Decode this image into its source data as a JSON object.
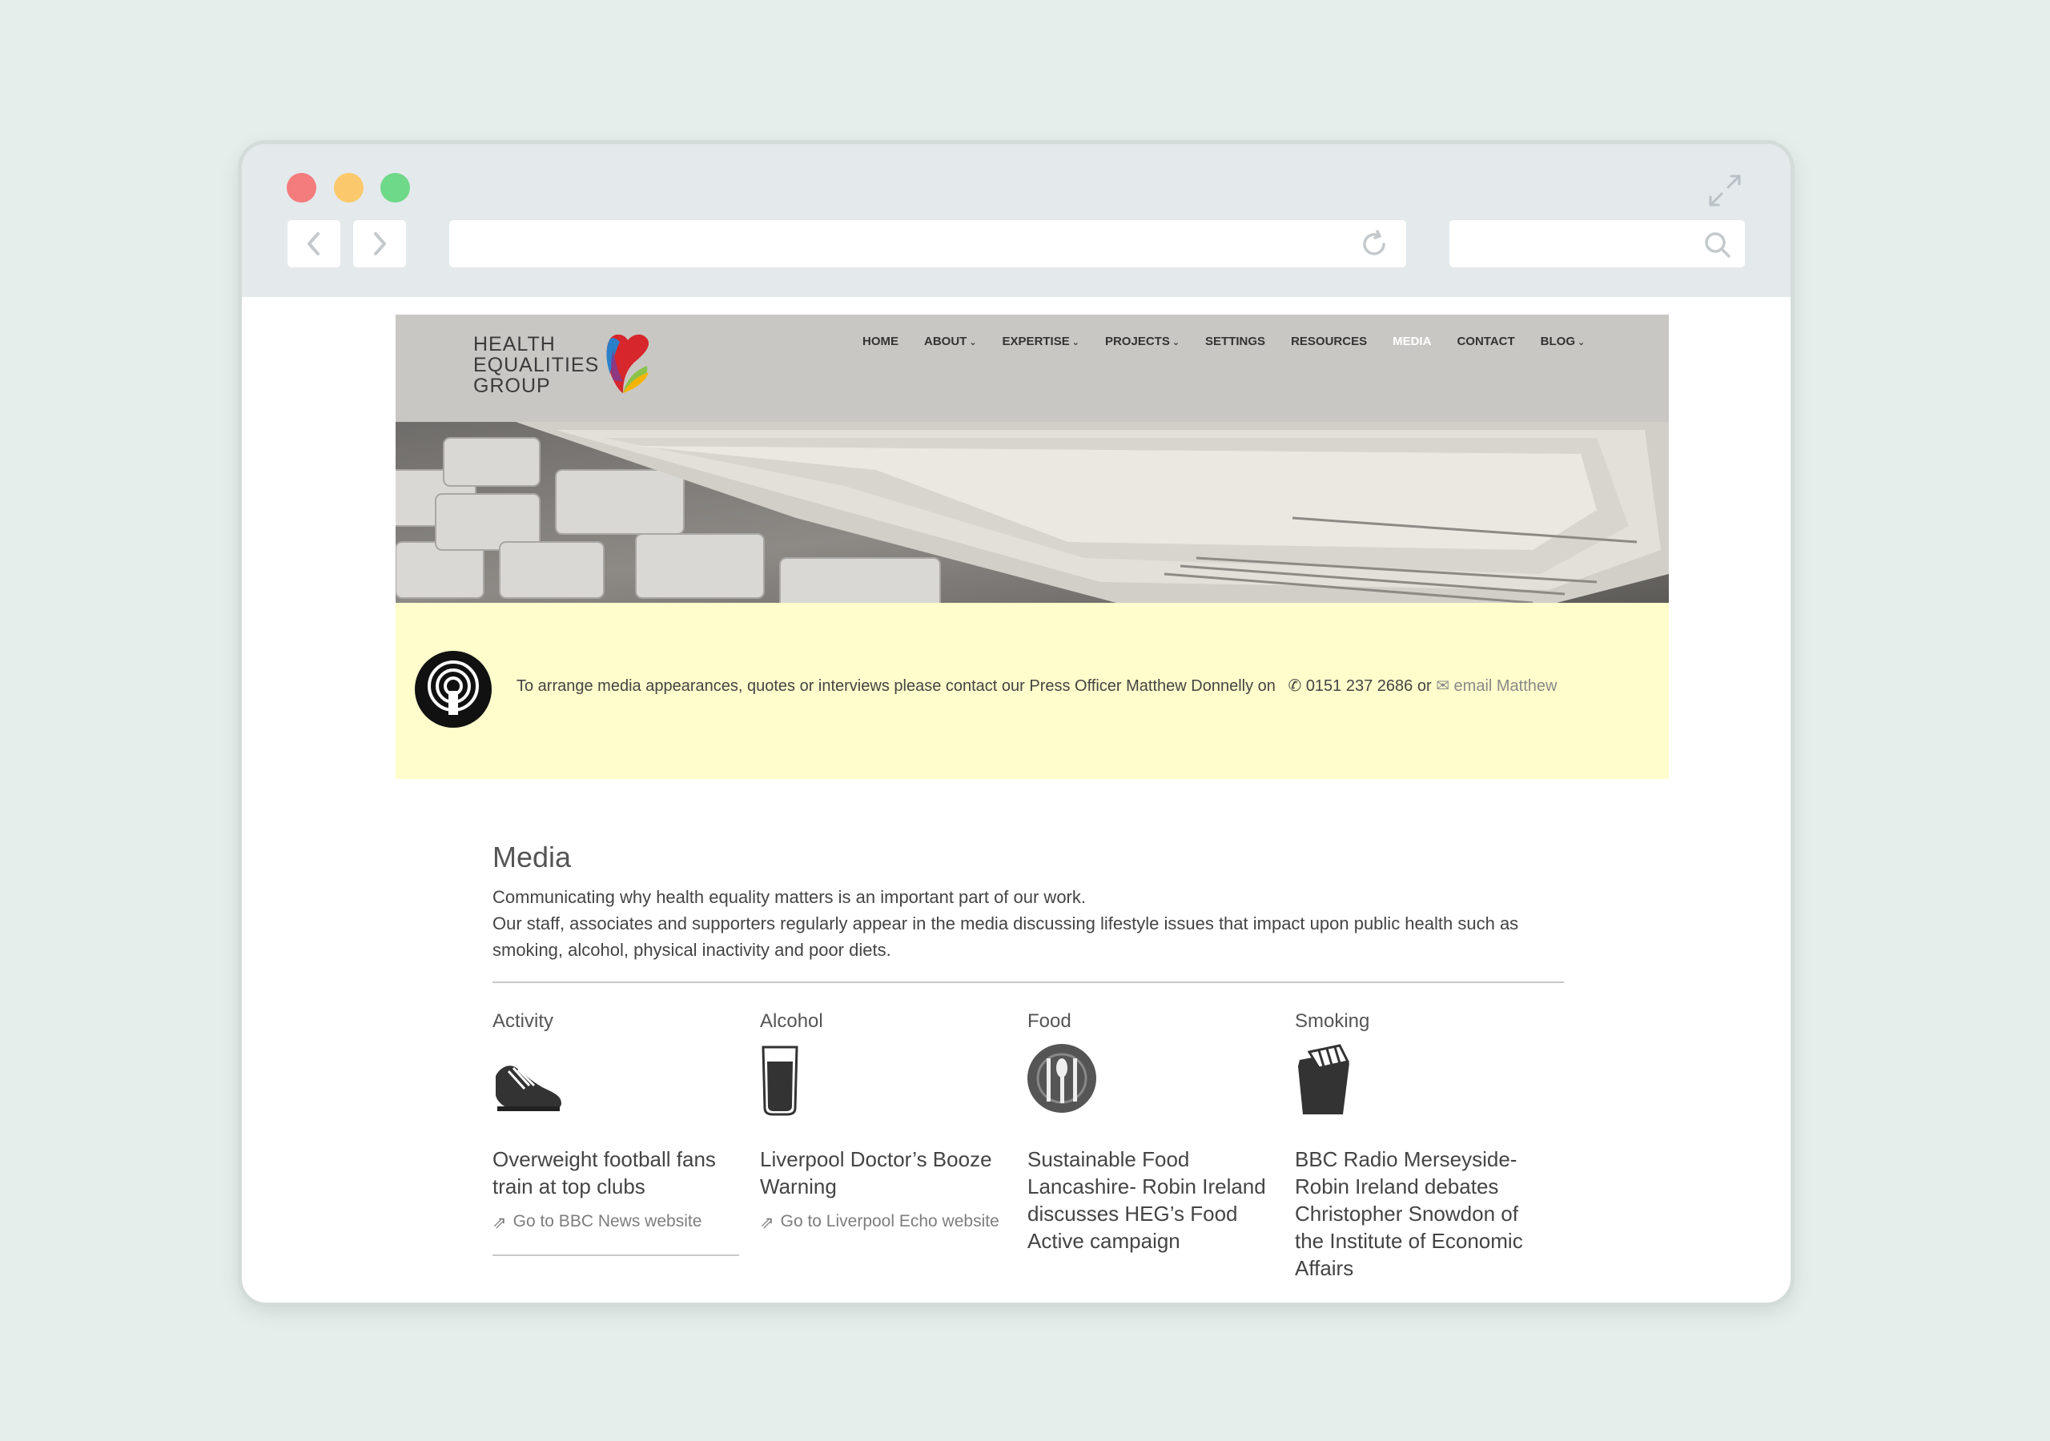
{
  "browser": {
    "url": "",
    "search_placeholder": ""
  },
  "site": {
    "logo": [
      "HEALTH",
      "EQUALITIES",
      "GROUP"
    ],
    "nav": [
      {
        "label": "HOME",
        "dropdown": false
      },
      {
        "label": "ABOUT",
        "dropdown": true
      },
      {
        "label": "EXPERTISE",
        "dropdown": true
      },
      {
        "label": "PROJECTS",
        "dropdown": true
      },
      {
        "label": "SETTINGS",
        "dropdown": false
      },
      {
        "label": "RESOURCES",
        "dropdown": false
      },
      {
        "label": "MEDIA",
        "dropdown": false,
        "active": true
      },
      {
        "label": "CONTACT",
        "dropdown": false
      },
      {
        "label": "BLOG",
        "dropdown": true
      }
    ]
  },
  "notice": {
    "text": "To arrange media appearances, quotes or interviews please contact our Press Officer Matthew Donnelly on",
    "phone": "0151 237 2686",
    "or": "or",
    "email_label": "email Matthew"
  },
  "media": {
    "title": "Media",
    "intro": [
      "Communicating why health equality matters is an important part of our work.",
      "Our staff, associates and supporters regularly appear in the media discussing lifestyle issues that impact upon public health such as smoking, alcohol, physical inactivity and poor diets."
    ],
    "columns": [
      {
        "title": "Activity",
        "icon": "running-shoe-icon",
        "article": "Overweight football fans train at top clubs",
        "link": "Go to BBC News website"
      },
      {
        "title": "Alcohol",
        "icon": "pint-glass-icon",
        "article": "Liverpool Doctor’s Booze Warning",
        "link": "Go to Liverpool Echo website"
      },
      {
        "title": "Food",
        "icon": "plate-cutlery-icon",
        "article": "Sustainable Food Lancashire- Robin Ireland discusses HEG’s Food Active campaign",
        "link": ""
      },
      {
        "title": "Smoking",
        "icon": "cigarette-pack-icon",
        "article": "BBC Radio Merseyside- Robin Ireland debates Christopher Snowdon of the Institute of Economic Affairs",
        "link": ""
      }
    ]
  },
  "colors": {
    "background": "#e5eeeb",
    "header": "#c8c7c3",
    "notice": "#fefdcb",
    "nav_active": "#ffffff"
  }
}
